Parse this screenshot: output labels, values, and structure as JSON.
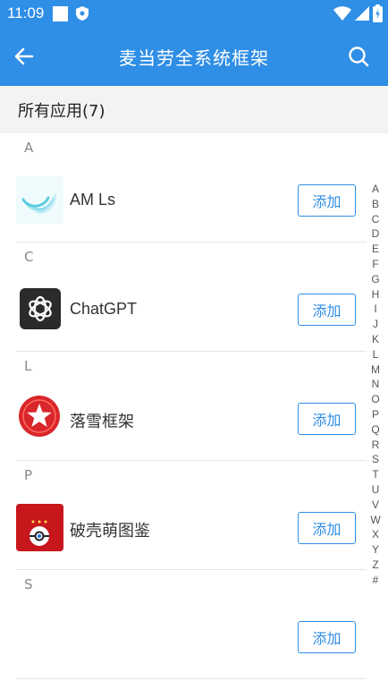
{
  "status_bar": {
    "time": "11:09"
  },
  "app_bar": {
    "title": "麦当劳全系统框架"
  },
  "subheader": {
    "label": "所有应用(7)"
  },
  "sections": [
    {
      "letter": "A",
      "app": {
        "name": "AM Ls",
        "button": "添加",
        "icon": "alight-motion-icon"
      }
    },
    {
      "letter": "C",
      "app": {
        "name": "ChatGPT",
        "button": "添加",
        "icon": "chatgpt-icon"
      }
    },
    {
      "letter": "L",
      "app": {
        "name": "落雪框架",
        "button": "添加",
        "icon": "star-badge-icon"
      }
    },
    {
      "letter": "P",
      "app": {
        "name": "破壳萌图鉴",
        "button": "添加",
        "icon": "pokeball-icon"
      }
    },
    {
      "letter": "S",
      "app": {
        "name": "",
        "button": "添加",
        "icon": ""
      }
    }
  ],
  "index_letters": [
    "A",
    "B",
    "C",
    "D",
    "E",
    "F",
    "G",
    "H",
    "I",
    "J",
    "K",
    "L",
    "M",
    "N",
    "O",
    "P",
    "Q",
    "R",
    "S",
    "T",
    "U",
    "V",
    "W",
    "X",
    "Y",
    "Z",
    "#"
  ],
  "colors": {
    "primary": "#2f8ee6",
    "subheader_bg": "#f3f3f3",
    "divider": "#e6e6e6"
  }
}
